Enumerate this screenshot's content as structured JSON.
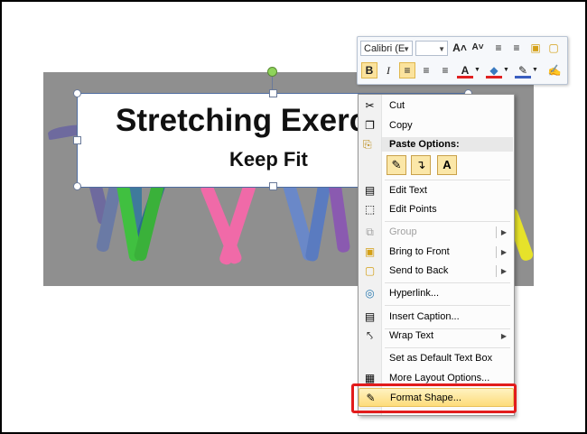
{
  "slide": {
    "title": "Stretching Exerc",
    "subtitle": "Keep Fit"
  },
  "mini_toolbar": {
    "font_name": "Calibri (E",
    "font_size": "",
    "buttons": [
      {
        "name": "grow-font-button",
        "glyph": "A˄"
      },
      {
        "name": "shrink-font-button",
        "glyph": "A˅"
      },
      {
        "name": "decrease-indent-button",
        "glyph": "≡"
      },
      {
        "name": "increase-indent-button",
        "glyph": "≡"
      },
      {
        "name": "bold-button",
        "glyph": "B"
      },
      {
        "name": "italic-button",
        "glyph": "I"
      },
      {
        "name": "align-left-button",
        "glyph": "≡"
      },
      {
        "name": "center-button",
        "glyph": "≡"
      },
      {
        "name": "align-right-button",
        "glyph": "≡"
      },
      {
        "name": "font-color-button",
        "glyph": "A"
      },
      {
        "name": "shape-fill-button",
        "glyph": "◆"
      },
      {
        "name": "shape-outline-button",
        "glyph": "✎"
      },
      {
        "name": "format-painter-button",
        "glyph": "✍"
      }
    ]
  },
  "context_menu": {
    "items": [
      {
        "label": "Cut",
        "icon": "scissors-icon",
        "glyph": "✂"
      },
      {
        "label": "Copy",
        "icon": "copy-icon",
        "glyph": "❐"
      },
      {
        "label": "Paste Options:",
        "icon": "clipboard-icon",
        "glyph": "⎘"
      },
      {
        "label": "Edit Text",
        "icon": "text-box-icon",
        "glyph": "▤"
      },
      {
        "label": "Edit Points",
        "icon": "points-icon",
        "glyph": "⬚"
      },
      {
        "label": "Group",
        "icon": "group-icon",
        "glyph": "⧉"
      },
      {
        "label": "Bring to Front",
        "icon": "bring-front-icon",
        "glyph": "▣"
      },
      {
        "label": "Send to Back",
        "icon": "send-back-icon",
        "glyph": "▢"
      },
      {
        "label": "Hyperlink...",
        "icon": "globe-link-icon",
        "glyph": "◎"
      },
      {
        "label": "Insert Caption...",
        "icon": "caption-icon",
        "glyph": "▤"
      },
      {
        "label": "Wrap Text",
        "icon": "wrap-text-icon",
        "glyph": "⤣"
      },
      {
        "label": "Set as Default Text Box",
        "icon": "",
        "glyph": ""
      },
      {
        "label": "More Layout Options...",
        "icon": "layout-icon",
        "glyph": "▦"
      },
      {
        "label": "Format Shape...",
        "icon": "format-shape-icon",
        "glyph": "✎"
      }
    ],
    "paste_options": [
      {
        "name": "paste-keep-formatting-button",
        "glyph": "✎"
      },
      {
        "name": "paste-merge-formatting-button",
        "glyph": "↴"
      },
      {
        "name": "paste-text-only-button",
        "glyph": "A"
      }
    ]
  },
  "colors": {
    "highlight_border": "#e21c1c",
    "menu_hover": "#fddc7a",
    "picture_bg": "#8f8f8f"
  }
}
